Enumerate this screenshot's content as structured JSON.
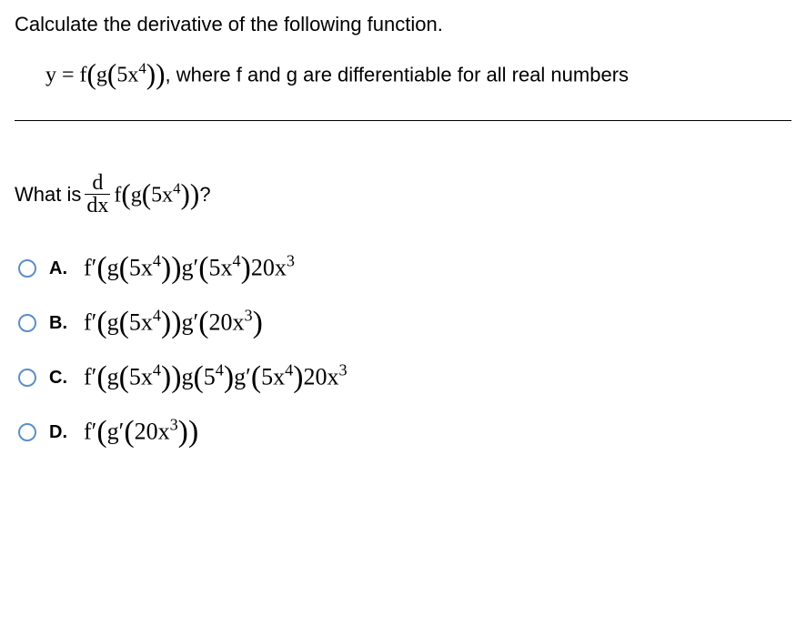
{
  "prompt": "Calculate the derivative of the following function.",
  "equation_prefix": "y = f",
  "equation_inner": "g",
  "equation_arg_base": "5x",
  "equation_arg_exp": "4",
  "equation_desc": ", where f and g are differentiable for all real numbers",
  "question_prefix": "What is ",
  "frac_top": "d",
  "frac_bot": "dx",
  "question_func": "f",
  "question_inner": "g",
  "question_arg_base": "5x",
  "question_arg_exp": "4",
  "question_suffix": "?",
  "options": {
    "A": {
      "label": "A.",
      "parts": {
        "fprime": "f′",
        "g_open": "g",
        "g_arg_base": "5x",
        "g_arg_exp": "4",
        "gprime": "g′",
        "gp_arg_base": "5x",
        "gp_arg_exp": "4",
        "tail_coef": "20x",
        "tail_exp": "3"
      }
    },
    "B": {
      "label": "B.",
      "parts": {
        "fprime": "f′",
        "g_open": "g",
        "g_arg_base": "5x",
        "g_arg_exp": "4",
        "gprime": "g′",
        "gp_arg_base": "20x",
        "gp_arg_exp": "3"
      }
    },
    "C": {
      "label": "C.",
      "parts": {
        "fprime": "f′",
        "g_open": "g",
        "g_arg_base": "5x",
        "g_arg_exp": "4",
        "g2": "g",
        "g2_arg_base": "5",
        "g2_arg_exp": "4",
        "gprime": "g′",
        "gp_arg_base": "5x",
        "gp_arg_exp": "4",
        "tail_coef": "20x",
        "tail_exp": "3"
      }
    },
    "D": {
      "label": "D.",
      "parts": {
        "fprime": "f′",
        "gprime": "g′",
        "gp_arg_base": "20x",
        "gp_arg_exp": "3"
      }
    }
  }
}
